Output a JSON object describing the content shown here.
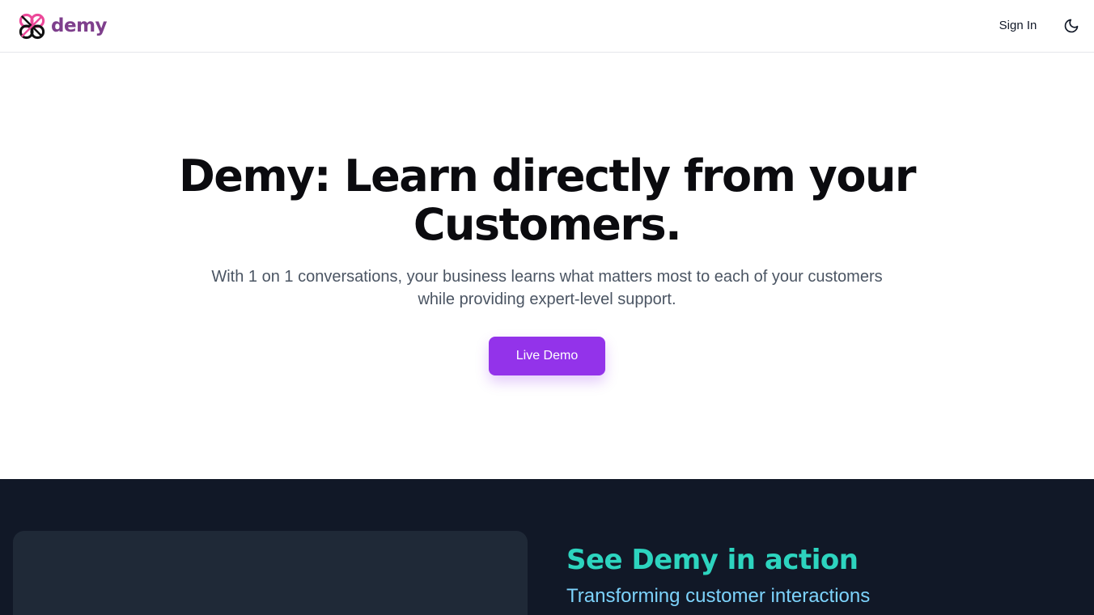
{
  "header": {
    "brand": "demy",
    "sign_in_label": "Sign In",
    "theme_toggle_icon": "moon-icon"
  },
  "hero": {
    "title_line1": "Demy: Learn directly from your",
    "title_line2": "Customers.",
    "subtitle_line1": "With 1 on 1 conversations, your business learns what matters most to each of your customers",
    "subtitle_line2": "while providing expert-level support.",
    "cta_label": "Live Demo"
  },
  "demo_section": {
    "title": "See Demy in action",
    "subtitle": "Transforming customer interactions"
  },
  "colors": {
    "brand_purple": "#9333ea",
    "logo_text": "#7e3f8c",
    "logo_pink": "#ec4899",
    "dark_bg": "#111827",
    "card_bg": "#1f2937",
    "teal": "#2dd4bf",
    "sky": "#7dd3fc"
  }
}
